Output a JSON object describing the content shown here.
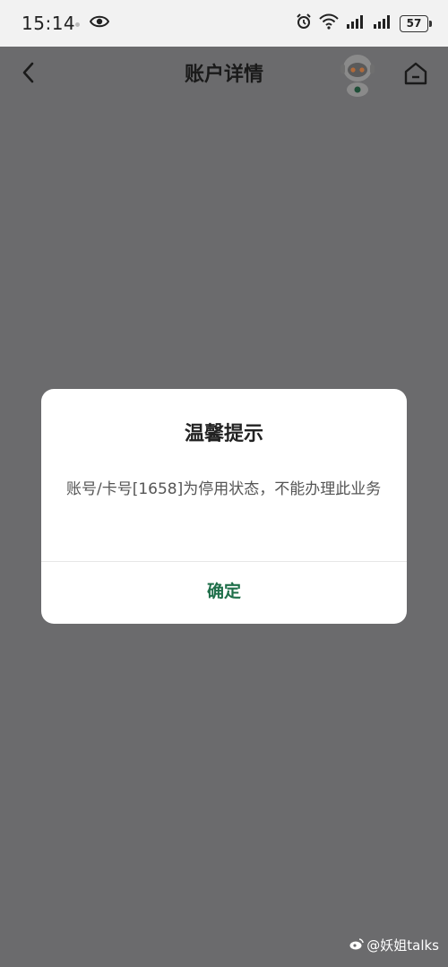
{
  "status_bar": {
    "time": "15:14",
    "battery": "57"
  },
  "header": {
    "title": "账户详情"
  },
  "dialog": {
    "title": "温馨提示",
    "message": "账号/卡号[1658]为停用状态，不能办理此业务",
    "confirm_label": "确定"
  },
  "watermark": {
    "text": "@妖姐talks"
  },
  "colors": {
    "accent": "#1f6f4a",
    "overlay": "#6b6b6d",
    "status_bar_bg": "#f2f2f2"
  },
  "icons": [
    "eye-icon",
    "alarm-icon",
    "wifi-icon",
    "signal-icon",
    "battery-icon",
    "back-icon",
    "robot-assistant-icon",
    "home-icon",
    "weibo-icon"
  ]
}
